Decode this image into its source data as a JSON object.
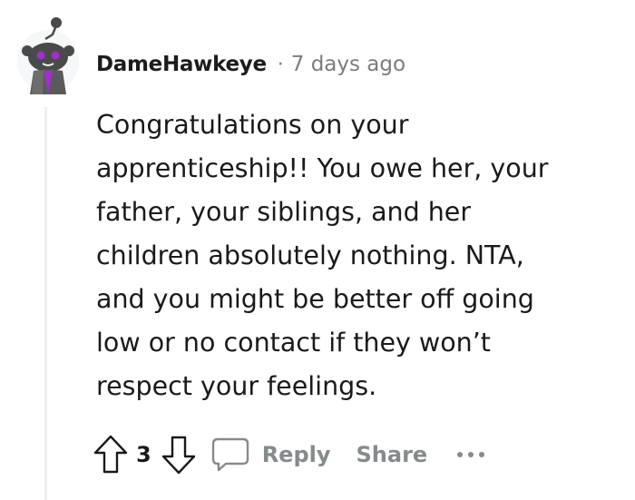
{
  "comment": {
    "username": "DameHawkeye",
    "separator": "·",
    "timestamp": "7 days ago",
    "body": "Congratulations on your\napprenticeship!! You owe her, your\nfather, your siblings, and her\nchildren absolutely nothing. NTA,\nand you might be better off going\nlow or no contact if they won’t\nrespect your feelings.",
    "score": "3"
  },
  "actions": {
    "reply_label": "Reply",
    "share_label": "Share"
  },
  "colors": {
    "avatar_body": "#4a4a4a",
    "avatar_accent": "#a030c8",
    "muted_text": "#878a8c",
    "thread_line": "#edeff1"
  },
  "icons": {
    "avatar": "snoo-avatar-icon",
    "upvote": "upvote-arrow-icon",
    "downvote": "downvote-arrow-icon",
    "reply": "comment-bubble-icon",
    "more": "more-options-icon"
  }
}
